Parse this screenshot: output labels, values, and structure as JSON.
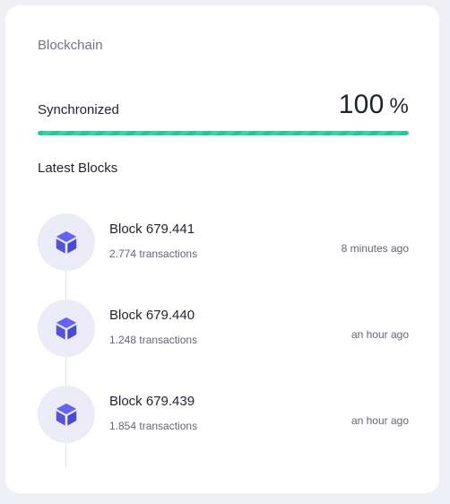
{
  "card": {
    "title": "Blockchain"
  },
  "sync": {
    "label": "Synchronized",
    "value": "100",
    "unit": "%",
    "progress_percent": 100,
    "progress_color": "#22c79d"
  },
  "latest": {
    "title": "Latest Blocks",
    "blocks": [
      {
        "name": "Block 679.441",
        "transactions": "2.774 transactions",
        "time": "8 minutes ago",
        "icon": "cube-icon"
      },
      {
        "name": "Block 679.440",
        "transactions": "1.248 transactions",
        "time": "an hour ago",
        "icon": "cube-icon"
      },
      {
        "name": "Block 679.439",
        "transactions": "1.854 transactions",
        "time": "an hour ago",
        "icon": "cube-icon"
      }
    ]
  },
  "colors": {
    "accent": "#5b5be6",
    "avatar_bg": "#ececf9"
  }
}
